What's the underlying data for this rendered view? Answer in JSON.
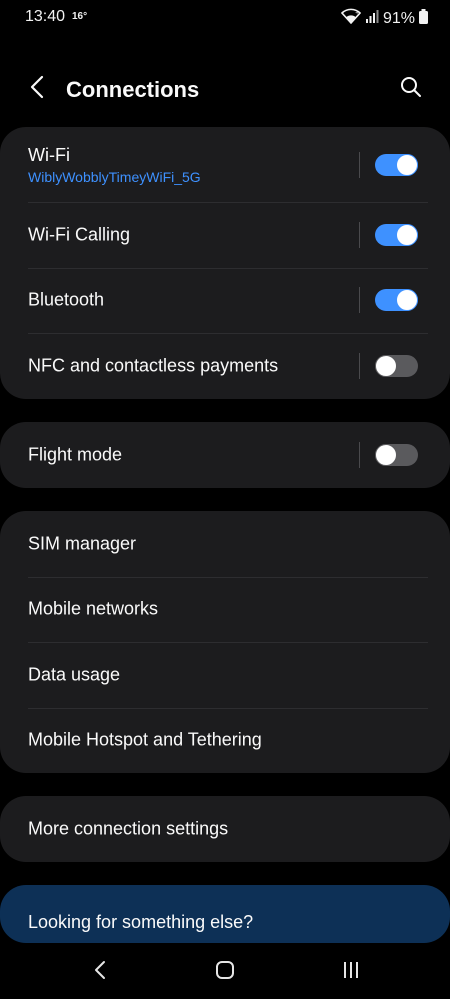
{
  "status_bar": {
    "time": "13:40",
    "temperature": "16°",
    "battery": "91%"
  },
  "header": {
    "title": "Connections"
  },
  "groups": {
    "radios": {
      "wifi": {
        "label": "Wi-Fi",
        "network": "WiblyWobblyTimeyWiFi_5G",
        "on": true
      },
      "wifi_calling": {
        "label": "Wi-Fi Calling",
        "on": true
      },
      "bluetooth": {
        "label": "Bluetooth",
        "on": true
      },
      "nfc": {
        "label": "NFC and contactless payments",
        "on": false
      }
    },
    "flight": {
      "label": "Flight mode",
      "on": false
    },
    "network_items": [
      "SIM manager",
      "Mobile networks",
      "Data usage",
      "Mobile Hotspot and Tethering"
    ],
    "more": "More connection settings"
  },
  "suggestion": {
    "label": "Looking for something else?"
  },
  "colors": {
    "accent": "#3e91ff",
    "card_bg": "#1c1c1e",
    "suggestion_bg": "#0d3056",
    "toggle_off": "#5a5a5d"
  },
  "icons": {
    "back": "back-arrow-icon",
    "search": "search-icon",
    "nav_back": "nav-back-icon",
    "nav_home": "nav-home-icon",
    "nav_recents": "nav-recents-icon"
  }
}
